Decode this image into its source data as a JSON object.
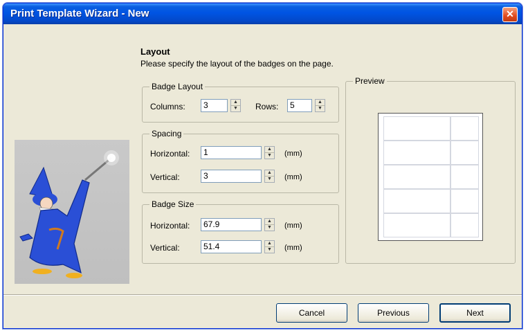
{
  "window": {
    "title": "Print Template Wizard - New",
    "close_glyph": "✕"
  },
  "page": {
    "heading": "Layout",
    "description": "Please specify the layout of the badges on the page."
  },
  "badge_layout": {
    "label": "Badge Layout",
    "columns_label": "Columns:",
    "columns_value": "3",
    "rows_label": "Rows:",
    "rows_value": "5"
  },
  "spacing": {
    "label": "Spacing",
    "horizontal_label": "Horizontal:",
    "horizontal_value": "1",
    "vertical_label": "Vertical:",
    "vertical_value": "3",
    "unit": "(mm)"
  },
  "badge_size": {
    "label": "Badge Size",
    "horizontal_label": "Horizontal:",
    "horizontal_value": "67.9",
    "vertical_label": "Vertical:",
    "vertical_value": "51.4",
    "unit": "(mm)"
  },
  "preview": {
    "label": "Preview",
    "columns": 2,
    "rows": 5
  },
  "buttons": {
    "cancel": "Cancel",
    "previous": "Previous",
    "next": "Next"
  },
  "icons": {
    "wizard": "wizard-illustration",
    "close": "close-icon",
    "spin": "spin-arrows-icon"
  },
  "colors": {
    "titlebar": "#0054e3",
    "dialog_bg": "#ece9d8",
    "close_button": "#e04a1e"
  }
}
